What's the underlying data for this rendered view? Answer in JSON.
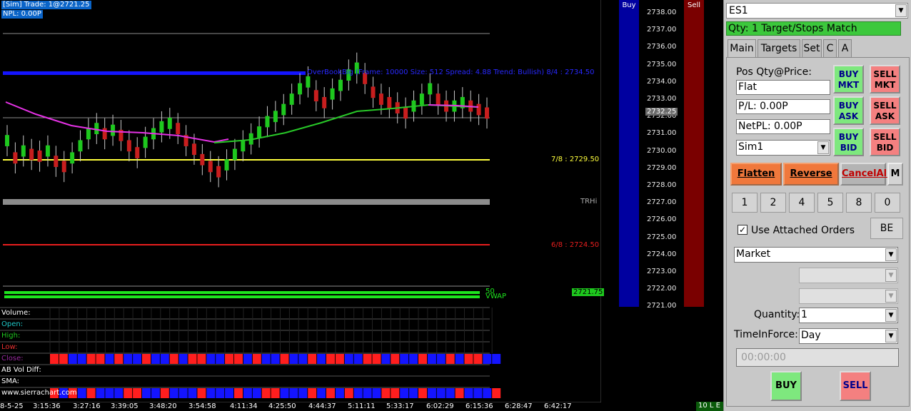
{
  "chart": {
    "trade_label": "[Sim]  Trade: 1@2721.25",
    "npl_label": "NPL: 0.00P",
    "overlay_label": "OverBookBig (Frame: 10000 Size: 512 Spread: 4.88 Trend: Bullish) 8/4 : 2734.50",
    "level_7_8": "7/8 : 2729.50",
    "level_trhi": "TRHi",
    "level_6_8": "6/8 : 2724.50",
    "vwap_top": "50",
    "vwap_label": "VWAP",
    "cur_price": "2732.25",
    "vwap_price": "2721.75",
    "price_ticks": [
      "2738.00",
      "2737.00",
      "2736.00",
      "2735.00",
      "2734.00",
      "2733.00",
      "2732.00",
      "2731.00",
      "2730.00",
      "2729.00",
      "2728.00",
      "2727.00",
      "2726.00",
      "2725.00",
      "2724.00",
      "2723.00",
      "2722.00",
      "2721.00"
    ],
    "time_labels": [
      "8-5-25",
      "3:15:36",
      "3:27:16",
      "3:39:05",
      "3:48:20",
      "3:54:58",
      "4:11:34",
      "4:25:50",
      "4:44:37",
      "5:11:11",
      "5:33:17",
      "6:02:29",
      "6:15:36",
      "6:28:47",
      "6:42:17"
    ],
    "study_names": [
      "Volume:",
      "Open:",
      "High:",
      "Low:",
      "Close:",
      "AB Vol Diff:",
      "SMA:",
      "www.sierrachart.com"
    ],
    "study_colors": [
      "#ffffff",
      "#1ec8c8",
      "#1ec81e",
      "#e83030",
      "#9a2aa0",
      "#ffffff",
      "#ffffff",
      "#ffffff"
    ],
    "buy_label": "Buy",
    "sell_label": "Sell",
    "status": "10 L E"
  },
  "panel": {
    "symbol": "ES1",
    "qty_line": "Qty: 1 Target/Stops Match",
    "tabs": [
      "Main",
      "Targets",
      "Set",
      "C",
      "A"
    ],
    "pos_label": "Pos Qty@Price:",
    "pos_value": "Flat",
    "pl_value": "P/L: 0.00P",
    "netpl_value": "NetPL: 0.00P",
    "account": "Sim1",
    "buy_mkt": "BUY MKT",
    "sell_mkt": "SELL MKT",
    "buy_ask": "BUY ASK",
    "sell_ask": "SELL ASK",
    "buy_bid": "BUY BID",
    "sell_bid": "SELL BID",
    "flatten": "Flatten",
    "reverse": "Reverse",
    "cancel_all": "CancelAll",
    "m_button": "M",
    "qty_buttons": [
      "1",
      "2",
      "4",
      "5",
      "8",
      "0"
    ],
    "use_attached": "Use Attached Orders",
    "be_button": "BE",
    "order_type": "Market",
    "quantity_label": "Quantity:",
    "quantity_value": "1",
    "tif_label": "TimeInForce:",
    "tif_value": "Day",
    "time_value": "00:00:00",
    "buy_button": "BUY",
    "sell_button": "SELL"
  },
  "colors": {
    "bull_candle": "#1ec81e",
    "bear_candle": "#c81e1e",
    "overlay_line": "#1414ff",
    "level_7_8": "#ffff3c",
    "level_6_8": "#e81e1e",
    "trhi": "#8c8c8c",
    "vwap": "#1ee61e",
    "sma_short": "#e632e6",
    "sma_long": "#28c828"
  }
}
